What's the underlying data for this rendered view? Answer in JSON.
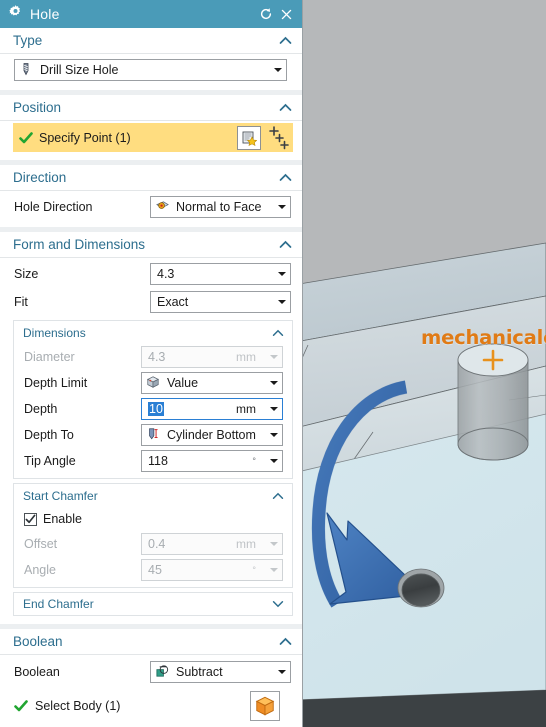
{
  "window": {
    "title": "Hole",
    "title_icon": "gear-icon",
    "reset_icon": "reset-arrow-icon",
    "close_icon": "close-icon",
    "titlebar_color": "#4a9bb8"
  },
  "sections": {
    "type": {
      "title": "Type",
      "expanded": true,
      "value": "Drill Size Hole",
      "icon": "drill-bit-icon"
    },
    "position": {
      "title": "Position",
      "expanded": true,
      "specify_point_label": "Specify Point (1)",
      "status_icon": "green-check-icon",
      "sketch_icon": "sketch-point-icon",
      "point_icon": "point-dialog-icon",
      "highlight_color": "#ffdd80"
    },
    "direction": {
      "title": "Direction",
      "expanded": true,
      "hole_direction_label": "Hole Direction",
      "hole_direction_value": "Normal to Face",
      "hole_direction_icon": "normal-to-face-icon"
    },
    "form_and_dimensions": {
      "title": "Form and Dimensions",
      "expanded": true,
      "size_label": "Size",
      "size_value": "4.3",
      "fit_label": "Fit",
      "fit_value": "Exact",
      "dimensions": {
        "title": "Dimensions",
        "expanded": true,
        "rows": [
          {
            "label": "Diameter",
            "value": "4.3",
            "unit": "mm",
            "disabled": true,
            "icon": ""
          },
          {
            "label": "Depth Limit",
            "value": "Value",
            "unit": "",
            "disabled": false,
            "icon": "value-cube-icon"
          },
          {
            "label": "Depth",
            "value": "10",
            "unit": "mm",
            "disabled": false,
            "icon": "",
            "selected": true
          },
          {
            "label": "Depth To",
            "value": "Cylinder Bottom",
            "unit": "",
            "disabled": false,
            "icon": "cylinder-bottom-icon"
          },
          {
            "label": "Tip Angle",
            "value": "118",
            "unit": "°",
            "disabled": false,
            "icon": ""
          }
        ]
      },
      "start_chamfer": {
        "title": "Start Chamfer",
        "expanded": true,
        "enable_label": "Enable",
        "enable_checked": true,
        "rows": [
          {
            "label": "Offset",
            "value": "0.4",
            "unit": "mm",
            "disabled": true
          },
          {
            "label": "Angle",
            "value": "45",
            "unit": "°",
            "disabled": true
          }
        ]
      },
      "end_chamfer": {
        "title": "End Chamfer",
        "expanded": false
      }
    },
    "boolean": {
      "title": "Boolean",
      "expanded": true,
      "boolean_label": "Boolean",
      "boolean_value": "Subtract",
      "boolean_icon": "subtract-icon",
      "select_body_label": "Select Body (1)",
      "select_body_status_icon": "green-check-icon",
      "body_icon": "orange-cube-icon"
    }
  },
  "viewport": {
    "watermark": "mechanicalengblog.com",
    "watermark_color": "#e07b16",
    "preview_cylinder": "hole-preview-cylinder",
    "point_marker": "orange-plus-marker",
    "annotation_arrow": "blue-curved-arrow",
    "result_hole": "drilled-hole",
    "background_color": "#b6b8ba"
  }
}
